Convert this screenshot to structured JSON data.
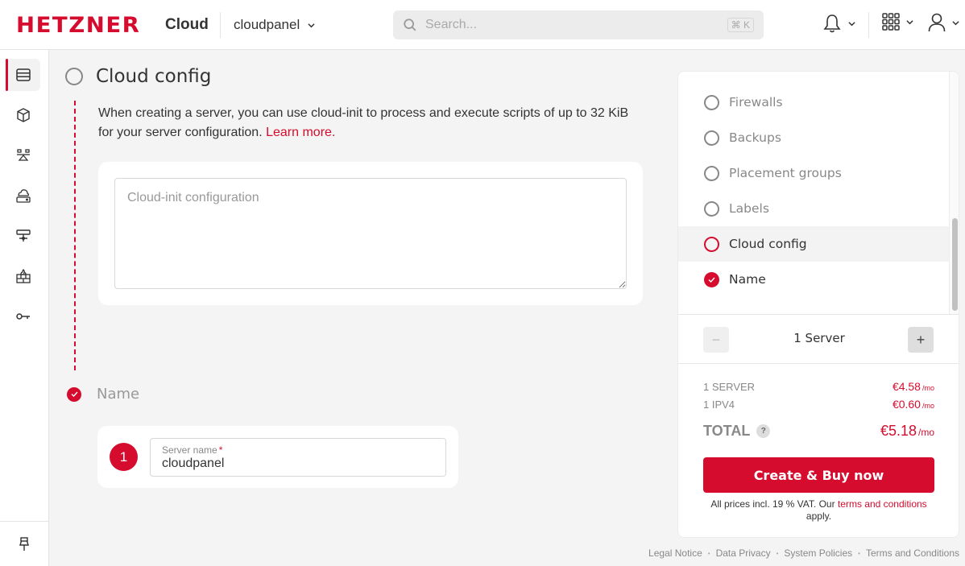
{
  "header": {
    "logo": "HETZNER",
    "product": "Cloud",
    "project": "cloudpanel",
    "search": {
      "placeholder": "Search...",
      "shortcut": "⌘ K"
    },
    "icons": [
      "bell-icon",
      "apps-grid-icon",
      "user-icon"
    ]
  },
  "sidebar": {
    "items": [
      {
        "name": "servers",
        "icon": "server-icon",
        "active": true
      },
      {
        "name": "volumes",
        "icon": "cube-icon"
      },
      {
        "name": "load-balancers",
        "icon": "load-balancer-icon"
      },
      {
        "name": "storage",
        "icon": "cloud-storage-icon"
      },
      {
        "name": "networks",
        "icon": "network-icon"
      },
      {
        "name": "firewalls",
        "icon": "firewall-icon"
      },
      {
        "name": "security",
        "icon": "key-icon"
      }
    ],
    "bottom_icon": "pin-icon"
  },
  "main": {
    "cloud_config": {
      "title": "Cloud config",
      "description": "When creating a server, you can use cloud-init to process and execute scripts of up to 32 KiB for your server configuration.",
      "learn_more": "Learn more.",
      "textarea_placeholder": "Cloud-init configuration",
      "textarea_value": ""
    },
    "name": {
      "title": "Name",
      "index": "1",
      "field_label": "Server name",
      "required_mark": "*",
      "field_value": "cloudpanel"
    }
  },
  "panel": {
    "nav": [
      {
        "label": "Firewalls",
        "state": "empty"
      },
      {
        "label": "Backups",
        "state": "empty"
      },
      {
        "label": "Placement groups",
        "state": "empty"
      },
      {
        "label": "Labels",
        "state": "empty"
      },
      {
        "label": "Cloud config",
        "state": "current"
      },
      {
        "label": "Name",
        "state": "done"
      }
    ],
    "quantity": {
      "label": "1 Server",
      "minus": "−",
      "plus": "+"
    },
    "prices": [
      {
        "label": "1 SERVER",
        "value": "€4.58",
        "per": "/mo"
      },
      {
        "label": "1 IPV4",
        "value": "€0.60",
        "per": "/mo"
      }
    ],
    "total": {
      "label": "TOTAL",
      "help": "?",
      "value": "€5.18",
      "per": "/mo"
    },
    "buy_button": "Create & Buy now",
    "vat_text": "All prices incl. 19 % VAT. Our",
    "vat_link": "terms and conditions",
    "vat_end": "apply."
  },
  "footer": {
    "links": [
      "Legal Notice",
      "Data Privacy",
      "System Policies",
      "Terms and Conditions"
    ]
  },
  "colors": {
    "brand": "#d50c2d",
    "background": "#f4f4f4"
  }
}
